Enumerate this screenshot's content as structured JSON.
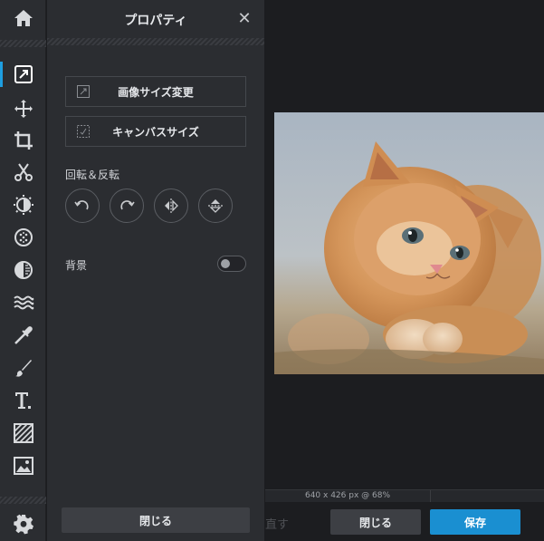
{
  "toolbar": {
    "tools": [
      {
        "icon": "home-icon"
      },
      {
        "icon": "resize-document-icon",
        "active": true
      },
      {
        "icon": "move-arrows-icon"
      },
      {
        "icon": "crop-icon"
      },
      {
        "icon": "scissors-icon"
      },
      {
        "icon": "adjust-icon"
      },
      {
        "icon": "effects-dots-icon"
      },
      {
        "icon": "contrast-icon"
      },
      {
        "icon": "waves-icon"
      },
      {
        "icon": "dropper-icon"
      },
      {
        "icon": "brush-icon"
      },
      {
        "icon": "text-icon"
      },
      {
        "icon": "pattern-icon"
      },
      {
        "icon": "image-icon"
      },
      {
        "icon": "settings-gear-icon"
      }
    ]
  },
  "panel": {
    "title": "プロパティ",
    "close_glyph": "✕",
    "resize_image_label": "画像サイズ変更",
    "canvas_size_label": "キャンバスサイズ",
    "rotate_flip_label": "回転＆反転",
    "background_label": "背景",
    "background_toggle_on": false,
    "close_label": "閉じる"
  },
  "canvas": {
    "status_text": "640 x 426 px @ 68%"
  },
  "bottom": {
    "ghost_label": "直す",
    "close_label": "閉じる",
    "save_label": "保存"
  },
  "colors": {
    "accent": "#1a8fd1",
    "active_indicator": "#1e9ee0",
    "panel_bg": "#2b2d31",
    "canvas_bg": "#1c1d20"
  }
}
